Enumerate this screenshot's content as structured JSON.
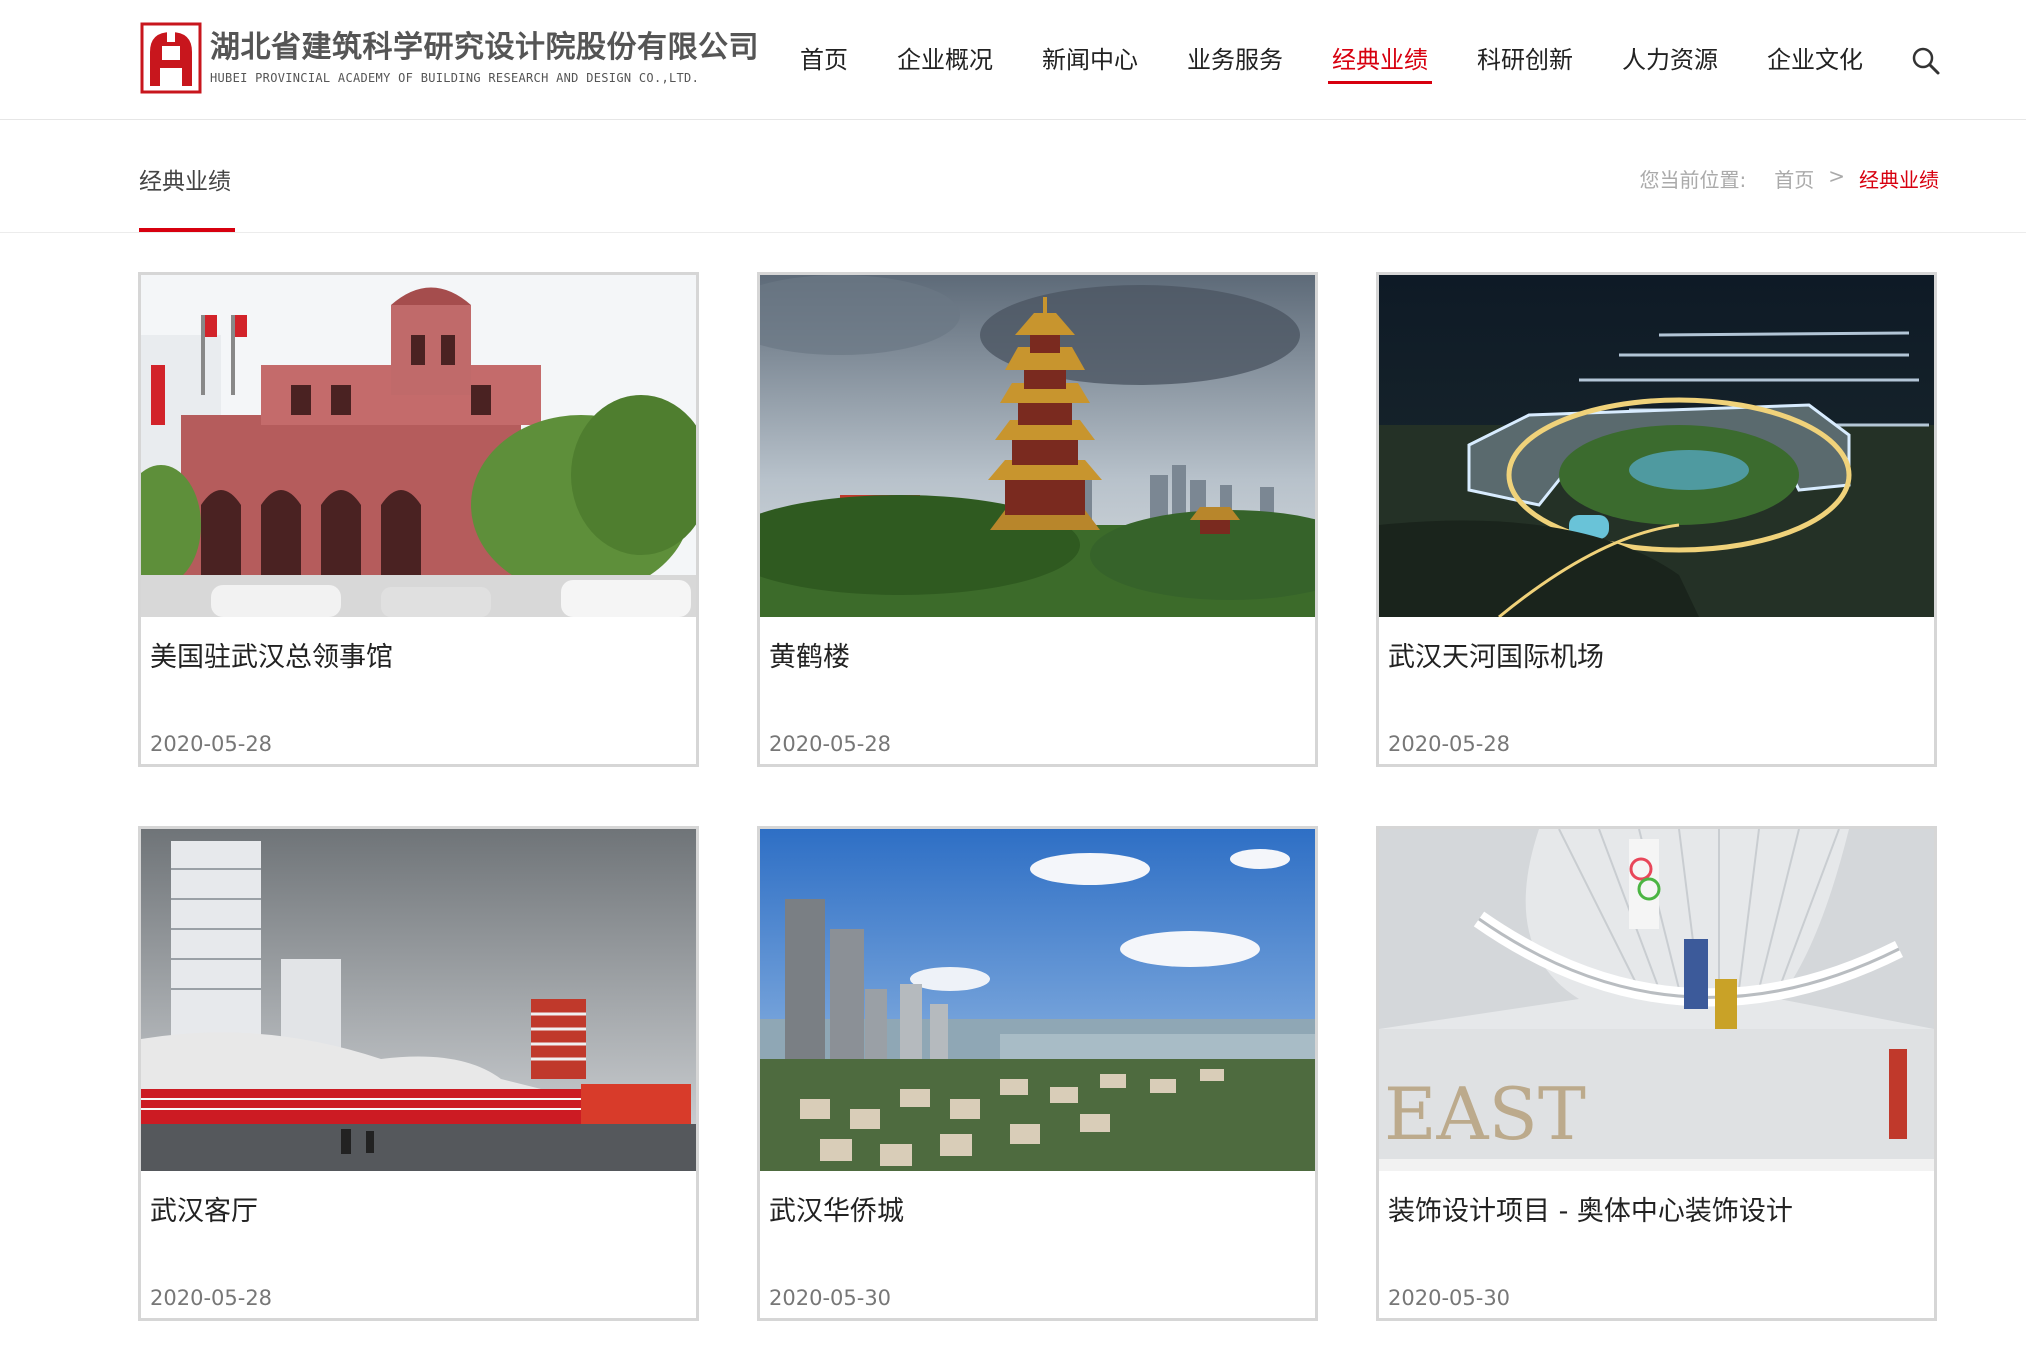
{
  "site": {
    "name_cn": "湖北省建筑科学研究设计院股份有限公司",
    "name_en": "HUBEI PROVINCIAL ACADEMY OF BUILDING RESEARCH AND DESIGN CO.,LTD.",
    "logo_icon": "academy-logo-icon",
    "accent_color": "#d7000f"
  },
  "nav": {
    "items": [
      {
        "label": "首页",
        "active": false
      },
      {
        "label": "企业概况",
        "active": false
      },
      {
        "label": "新闻中心",
        "active": false
      },
      {
        "label": "业务服务",
        "active": false
      },
      {
        "label": "经典业绩",
        "active": true
      },
      {
        "label": "科研创新",
        "active": false
      },
      {
        "label": "人力资源",
        "active": false
      },
      {
        "label": "企业文化",
        "active": false
      }
    ],
    "search_icon": "search-icon"
  },
  "page": {
    "section_title": "经典业绩",
    "breadcrumb": {
      "prefix": "您当前位置:",
      "home": "首页",
      "separator": ">",
      "current": "经典业绩"
    }
  },
  "projects": [
    {
      "title": "美国驻武汉总领事馆",
      "date": "2020-05-28",
      "image": "consulate-building-photo"
    },
    {
      "title": "黄鹤楼",
      "date": "2020-05-28",
      "image": "yellow-crane-tower-photo"
    },
    {
      "title": "武汉天河国际机场",
      "date": "2020-05-28",
      "image": "airport-night-render"
    },
    {
      "title": "武汉客厅",
      "date": "2020-05-28",
      "image": "wuhan-living-room-render"
    },
    {
      "title": "武汉华侨城",
      "date": "2020-05-30",
      "image": "oct-residential-aerial-photo"
    },
    {
      "title": "装饰设计项目 - 奥体中心装饰设计",
      "date": "2020-05-30",
      "image": "sports-center-interior-render"
    }
  ]
}
